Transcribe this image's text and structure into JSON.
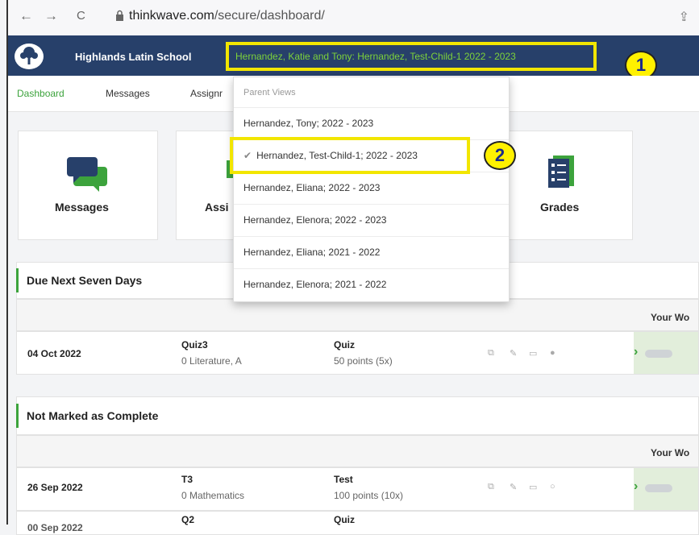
{
  "browser": {
    "back": "←",
    "forward": "→",
    "reload": "C",
    "url_host": "thinkwave.com",
    "url_path": "/secure/dashboard/"
  },
  "header": {
    "school_name": "Highlands Latin School",
    "student_selector": "Hernandez, Katie and Tony: Hernandez, Test-Child-1 2022 - 2023"
  },
  "callouts": {
    "one": "1",
    "two": "2"
  },
  "nav": {
    "items": [
      "Dashboard",
      "Messages",
      "Assignr"
    ]
  },
  "tiles": {
    "messages": "Messages",
    "assignments_partial": "Assi",
    "grades": "Grades"
  },
  "dropdown": {
    "header": "Parent Views",
    "check": "✔",
    "items": [
      "Hernandez, Tony; 2022 - 2023",
      "Hernandez, Test-Child-1; 2022 - 2023",
      "Hernandez, Eliana; 2022 - 2023",
      "Hernandez, Elenora; 2022 - 2023",
      "Hernandez, Eliana; 2021 - 2022",
      "Hernandez, Elenora; 2021 - 2022"
    ]
  },
  "due": {
    "title": "Due Next Seven Days",
    "col_head": "Your Wo",
    "row": {
      "date": "04 Oct 2022",
      "name": "Quiz3",
      "class": "0 Literature, A",
      "type": "Quiz",
      "points": "50 points (5x)"
    }
  },
  "not_marked": {
    "title": "Not Marked as Complete",
    "col_head": "Your Wo",
    "rows": [
      {
        "date": "26 Sep 2022",
        "name": "T3",
        "class": "0 Mathematics",
        "type": "Test",
        "points": "100 points (10x)"
      },
      {
        "date": "00 Sep 2022",
        "name": "Q2",
        "type": "Quiz"
      }
    ]
  },
  "colors": {
    "header_bg": "#27406a",
    "accent_green": "#3ca33c",
    "highlight": "#f2e600"
  }
}
